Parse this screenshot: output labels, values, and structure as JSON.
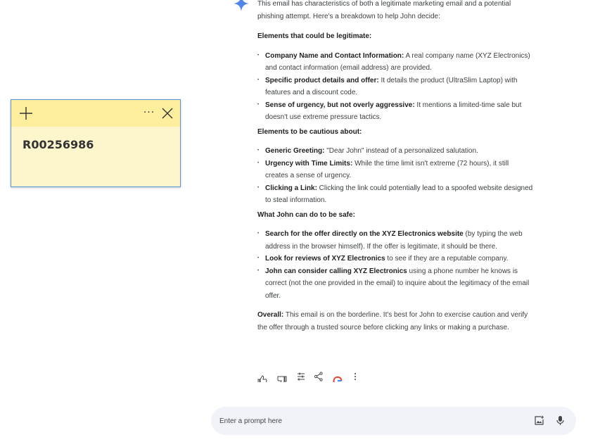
{
  "sticky_note": {
    "text": "R00256986",
    "add_icon": "plus-icon",
    "more_icon": "more-horizontal-icon",
    "close_icon": "close-icon"
  },
  "response": {
    "intro": "This email has characteristics of both a legitimate marketing email and a potential phishing attempt. Here's a breakdown to help John decide:",
    "section1": {
      "heading": "Elements that could be legitimate:",
      "items": [
        {
          "bold": "Company Name and Contact Information:",
          "text": " A real company name (XYZ Electronics) and contact information (email address) are provided."
        },
        {
          "bold": "Specific product details and offer:",
          "text": " It details the product (UltraSlim Laptop) with features and a discount code."
        },
        {
          "bold": "Sense of urgency, but not overly aggressive:",
          "text": " It mentions a limited-time sale but doesn't use extreme pressure tactics."
        }
      ]
    },
    "section2": {
      "heading": "Elements to be cautious about:",
      "items": [
        {
          "bold": "Generic Greeting:",
          "text": " \"Dear John\" instead of a personalized salutation."
        },
        {
          "bold": "Urgency with Time Limits:",
          "text": " While the time limit isn't extreme (72 hours), it still creates a sense of urgency."
        },
        {
          "bold": "Clicking a Link:",
          "text": " Clicking the link could potentially lead to a spoofed website designed to steal information."
        }
      ]
    },
    "section3": {
      "heading": "What John can do to be safe:",
      "items": [
        {
          "bold": "Search for the offer directly on the XYZ Electronics website",
          "text": " (by typing the web address in the browser himself). If the offer is legitimate, it should be there."
        },
        {
          "bold": "Look for reviews of XYZ Electronics",
          "text": " to see if they are a reputable company."
        },
        {
          "bold": "John can consider calling XYZ Electronics",
          "text": " using a phone number he knows is correct (not the one provided in the email) to inquire about the legitimacy of the email offer."
        }
      ]
    },
    "overall": {
      "bold": "Overall:",
      "text": " This email is on the borderline. It's best for John to exercise caution and verify the offer through a trusted source before clicking any links or making a purchase."
    }
  },
  "actions": [
    "thumbs-up-icon",
    "thumbs-down-icon",
    "tune-icon",
    "share-icon",
    "google-g-icon",
    "more-vertical-icon"
  ],
  "prompt": {
    "placeholder": "Enter a prompt here",
    "image_icon": "add-image-icon",
    "mic_icon": "mic-icon"
  },
  "colors": {
    "sticky_header": "#fdef9e",
    "sticky_body": "#fdf6cd",
    "sticky_border": "#5b8fd6",
    "prompt_bg": "#f0f4f9",
    "gemini_blue": "#4f86e8"
  }
}
